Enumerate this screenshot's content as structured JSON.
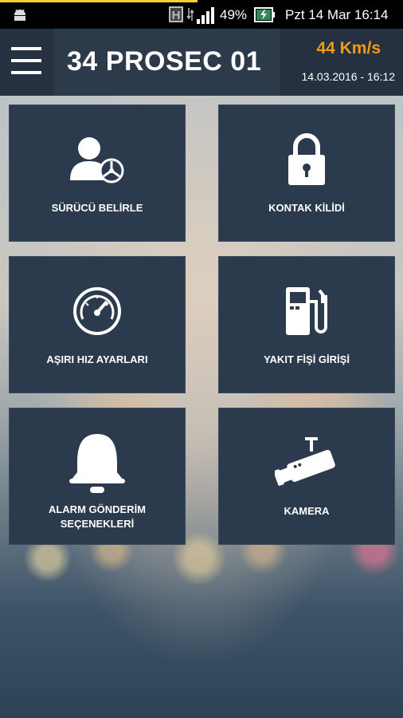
{
  "status_bar": {
    "battery": "49%",
    "datetime": "Pzt 14 Mar 16:14",
    "h_indicator": "H",
    "progress": 0.49
  },
  "header": {
    "menu_icon": "hamburger-menu-icon",
    "title": "34 PROSEC 01",
    "speed": "44 Km/s",
    "datetime": "14.03.2016 - 16:12"
  },
  "tiles": [
    {
      "label": "SÜRÜCÜ BELİRLE",
      "icon": "driver-steering-wheel-icon"
    },
    {
      "label": "KONTAK KİLİDİ",
      "icon": "padlock-icon"
    },
    {
      "label": "AŞIRI HIZ AYARLARI",
      "icon": "speedometer-icon"
    },
    {
      "label": "YAKIT FİŞİ GİRİŞİ",
      "icon": "fuel-pump-icon"
    },
    {
      "label": "ALARM GÖNDERİM\nSEÇENEKLERİ",
      "icon": "bell-icon"
    },
    {
      "label": "KAMERA",
      "icon": "security-camera-icon"
    }
  ],
  "colors": {
    "header_bg": "#2d3a4a",
    "tile_bg": "#2b3a4c",
    "speed": "#f39c12",
    "status_progress": "#f4d03f"
  }
}
